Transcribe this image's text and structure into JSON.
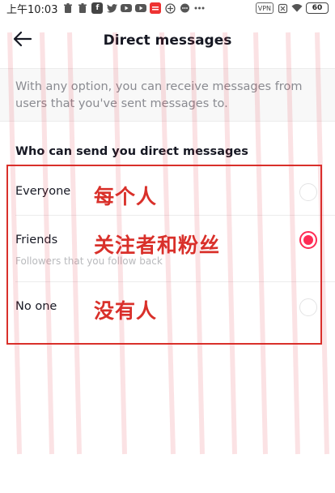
{
  "status_bar": {
    "time": "上午10:03",
    "left_icons": [
      "trash-icon",
      "trash-icon",
      "facebook-icon",
      "twitter-icon",
      "youtube-icon",
      "youtube-icon",
      "news-app-icon",
      "location-icon",
      "chat-icon",
      "more-icon"
    ],
    "vpn_label": "VPN",
    "battery": "60"
  },
  "header": {
    "title": "Direct messages"
  },
  "info": {
    "text": "With any option, you can receive messages from users that you've sent messages to."
  },
  "section": {
    "label": "Who can send you direct messages"
  },
  "options": [
    {
      "label": "Everyone",
      "sublabel": "",
      "selected": false
    },
    {
      "label": "Friends",
      "sublabel": "Followers that you follow back",
      "selected": true
    },
    {
      "label": "No one",
      "sublabel": "",
      "selected": false
    }
  ],
  "annotations": {
    "everyone": "每个人",
    "friends": "关注者和粉丝",
    "no_one": "没有人"
  },
  "colors": {
    "accent": "#fe2c55",
    "annotation": "#d9302a"
  }
}
